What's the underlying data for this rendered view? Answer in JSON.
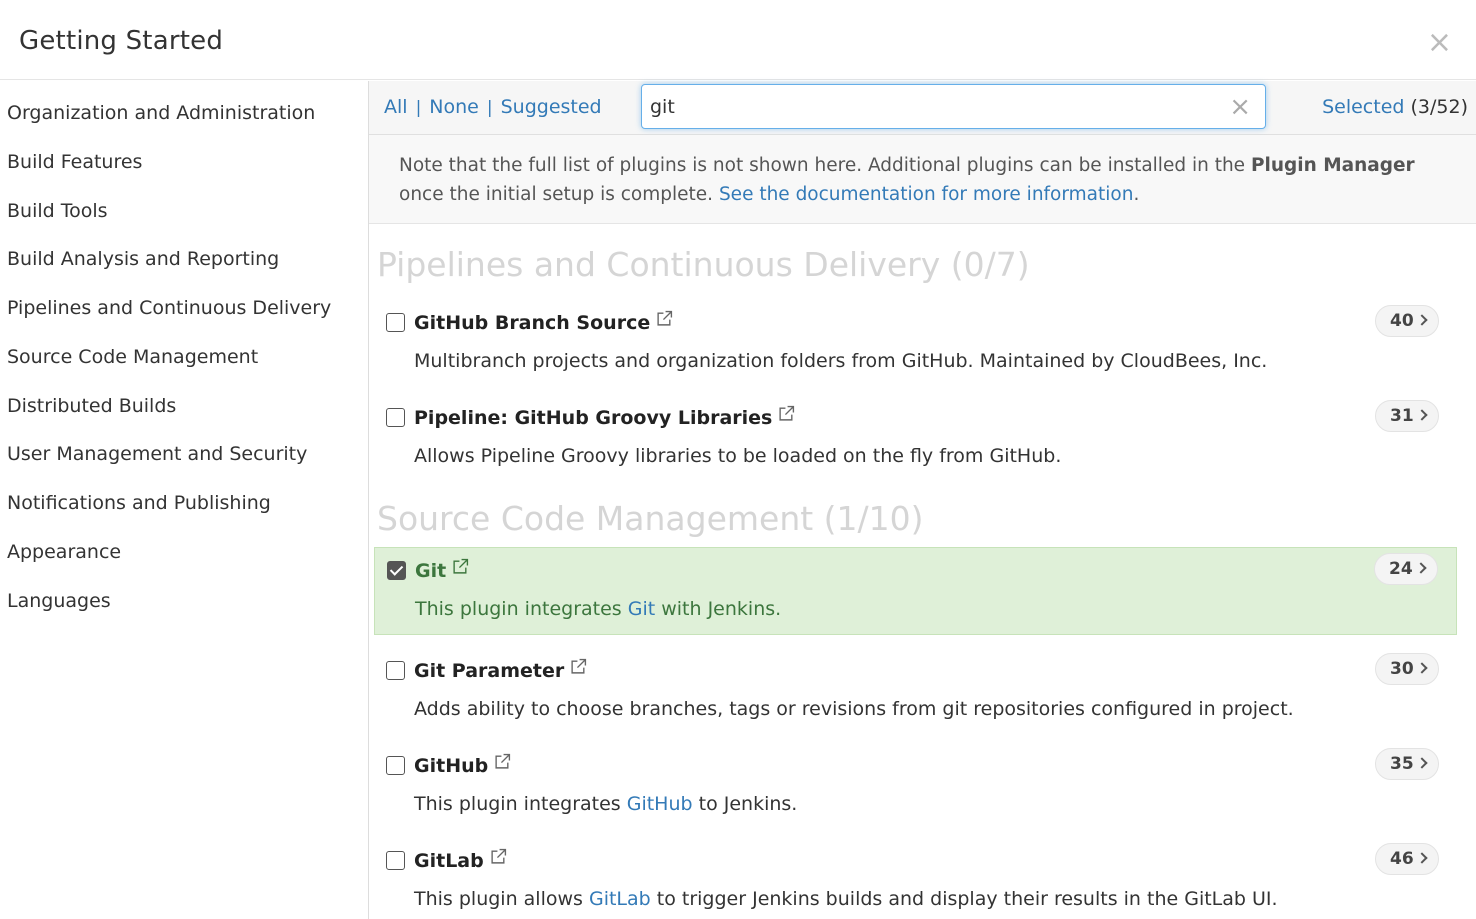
{
  "header": {
    "title": "Getting Started",
    "close_label": "×"
  },
  "sidebar": {
    "items": [
      {
        "label": "Organization and Administration"
      },
      {
        "label": "Build Features"
      },
      {
        "label": "Build Tools"
      },
      {
        "label": "Build Analysis and Reporting"
      },
      {
        "label": "Pipelines and Continuous Delivery"
      },
      {
        "label": "Source Code Management"
      },
      {
        "label": "Distributed Builds"
      },
      {
        "label": "User Management and Security"
      },
      {
        "label": "Notifications and Publishing"
      },
      {
        "label": "Appearance"
      },
      {
        "label": "Languages"
      }
    ]
  },
  "toolbar": {
    "all_label": "All",
    "none_label": "None",
    "suggested_label": "Suggested",
    "separator": "|",
    "search_value": "git",
    "clear_label": "×",
    "selected_link": "Selected",
    "selected_count": "(3/52)"
  },
  "note": {
    "text_before": "Note that the full list of plugins is not shown here. Additional plugins can be installed in the ",
    "plugin_manager": "Plugin Manager",
    "text_after": " once the initial setup is complete. ",
    "doc_link": "See the documentation for more information",
    "period": "."
  },
  "sections": [
    {
      "title": "Pipelines and Continuous Delivery (0/7)",
      "plugins": [
        {
          "name": "GitHub Branch Source",
          "checked": false,
          "count": "40",
          "desc_before": "Multibranch projects and organization folders from GitHub. Maintained by CloudBees, Inc.",
          "desc_link": "",
          "desc_after": ""
        },
        {
          "name": "Pipeline: GitHub Groovy Libraries",
          "checked": false,
          "count": "31",
          "desc_before": "Allows Pipeline Groovy libraries to be loaded on the fly from GitHub.",
          "desc_link": "",
          "desc_after": ""
        }
      ]
    },
    {
      "title": "Source Code Management (1/10)",
      "plugins": [
        {
          "name": "Git",
          "checked": true,
          "count": "24",
          "desc_before": "This plugin integrates ",
          "desc_link": "Git",
          "desc_after": " with Jenkins."
        },
        {
          "name": "Git Parameter",
          "checked": false,
          "count": "30",
          "desc_before": "Adds ability to choose branches, tags or revisions from git repositories configured in project.",
          "desc_link": "",
          "desc_after": ""
        },
        {
          "name": "GitHub",
          "checked": false,
          "count": "35",
          "desc_before": "This plugin integrates ",
          "desc_link": "GitHub",
          "desc_after": " to Jenkins."
        },
        {
          "name": "GitLab",
          "checked": false,
          "count": "46",
          "desc_before": "This plugin allows ",
          "desc_link": "GitLab",
          "desc_after": " to trigger Jenkins builds and display their results in the GitLab UI."
        }
      ]
    }
  ],
  "colors": {
    "link": "#337ab7",
    "selected_bg": "#dff0d8",
    "selected_text": "#3c763d",
    "section_title": "#d5d5d5"
  },
  "icons": {
    "external_link": "external-link-icon",
    "chevron": "chevron-right-icon",
    "close": "close-icon"
  }
}
